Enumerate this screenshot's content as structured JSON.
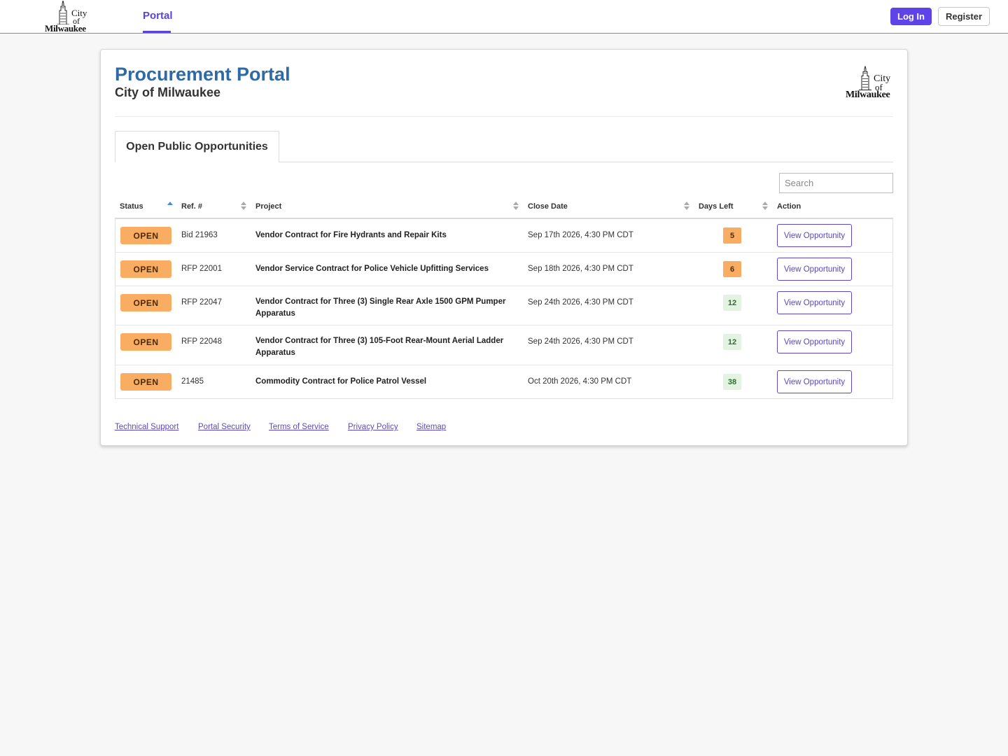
{
  "header": {
    "logo_text": [
      "City",
      "of",
      "Milwaukee"
    ],
    "nav_portal": "Portal",
    "login_label": "Log In",
    "register_label": "Register"
  },
  "page": {
    "title": "Procurement Portal",
    "subtitle": "City of Milwaukee",
    "tab_label": "Open Public Opportunities",
    "search_placeholder": "Search"
  },
  "table": {
    "columns": [
      "Status",
      "Ref. #",
      "Project",
      "Close Date",
      "Days Left",
      "Action"
    ],
    "sorted_column": "Status",
    "sort_direction": "ascending",
    "rows": [
      {
        "status": "OPEN",
        "ref": "Bid 21963",
        "project": "Vendor Contract for Fire Hydrants and Repair Kits",
        "close_date": "Sep 17th 2026, 4:30 PM CDT",
        "days_left": "5",
        "days_level": "warn",
        "action": "View Opportunity"
      },
      {
        "status": "OPEN",
        "ref": "RFP 22001",
        "project": "Vendor Service Contract for Police Vehicle Upfitting Services",
        "close_date": "Sep 18th 2026, 4:30 PM CDT",
        "days_left": "6",
        "days_level": "warn",
        "action": "View Opportunity"
      },
      {
        "status": "OPEN",
        "ref": "RFP 22047",
        "project": "Vendor Contract for Three (3) Single Rear Axle 1500 GPM Pumper Apparatus",
        "close_date": "Sep 24th 2026, 4:30 PM CDT",
        "days_left": "12",
        "days_level": "ok",
        "action": "View Opportunity"
      },
      {
        "status": "OPEN",
        "ref": "RFP 22048",
        "project": "Vendor Contract for Three (3) 105-Foot Rear-Mount Aerial Ladder Apparatus",
        "close_date": "Sep 24th 2026, 4:30 PM CDT",
        "days_left": "12",
        "days_level": "ok",
        "action": "View Opportunity"
      },
      {
        "status": "OPEN",
        "ref": "21485",
        "project": "Commodity Contract for Police Patrol Vessel",
        "close_date": "Oct 20th 2026, 4:30 PM CDT",
        "days_left": "38",
        "days_level": "ok",
        "action": "View Opportunity"
      }
    ]
  },
  "footer": {
    "links": [
      "Technical Support",
      "Portal Security",
      "Terms of Service",
      "Privacy Policy",
      "Sitemap"
    ]
  },
  "colors": {
    "accent": "#5d43e8",
    "title_blue": "#2f6aa6",
    "status_open": "#f8ad63",
    "days_ok_bg": "#e2f3e2"
  }
}
